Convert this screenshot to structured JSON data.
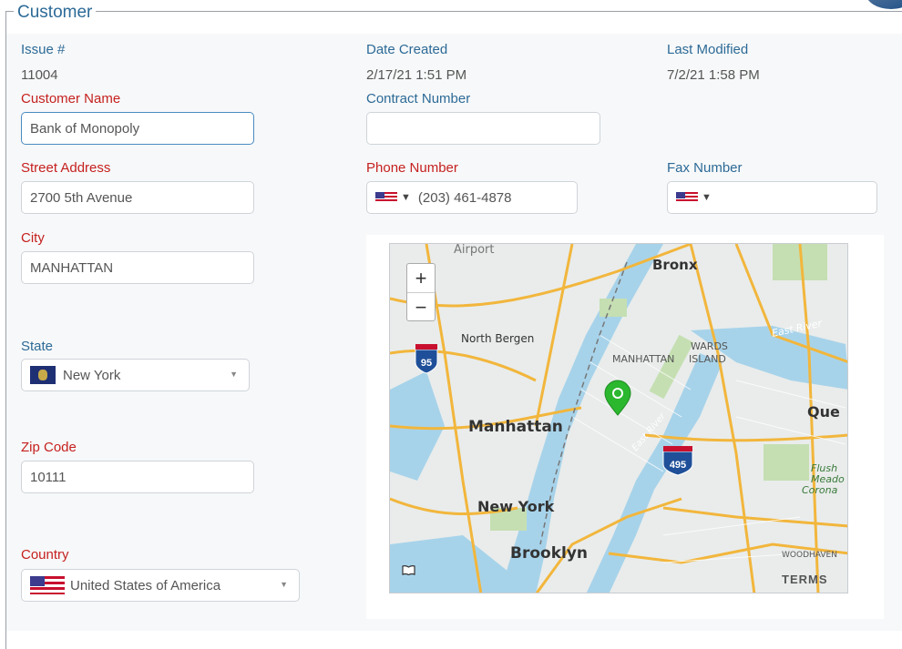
{
  "section": {
    "legend": "Customer"
  },
  "issue": {
    "label": "Issue #",
    "value": "11004"
  },
  "date_created": {
    "label": "Date Created",
    "value": "2/17/21 1:51 PM"
  },
  "last_modified": {
    "label": "Last Modified",
    "value": "7/2/21 1:58 PM"
  },
  "customer_name": {
    "label": "Customer Name",
    "value": "Bank of Monopoly"
  },
  "contract_number": {
    "label": "Contract Number",
    "value": ""
  },
  "street_address": {
    "label": "Street Address",
    "value": "2700 5th Avenue"
  },
  "phone_number": {
    "label": "Phone Number",
    "value": "(203) 461-4878",
    "country_caret": "▼"
  },
  "fax_number": {
    "label": "Fax Number",
    "value": "",
    "country_caret": "▼"
  },
  "city": {
    "label": "City",
    "value": "MANHATTAN"
  },
  "state": {
    "label": "State",
    "value": "New York",
    "arrow": "▼"
  },
  "zip_code": {
    "label": "Zip Code",
    "value": "10111"
  },
  "country": {
    "label": "Country",
    "value": "United States of America",
    "arrow": "▼"
  },
  "map": {
    "zoom_in": "+",
    "zoom_out": "−",
    "terms": "TERMS",
    "labels": {
      "airport": "Airport",
      "bronx": "Bronx",
      "north_bergen": "North Bergen",
      "manhattan_caps": "MANHATTAN",
      "wards": "WARDS",
      "island": "ISLAND",
      "east_river": "East River",
      "east_river_2": "East River",
      "manhattan": "Manhattan",
      "queens": "Que",
      "new_york": "New York",
      "brooklyn": "Brooklyn",
      "flushing": "Flush",
      "meadow": "Meado",
      "corona": "Corona",
      "woodhaven": "WOODHAVEN",
      "i95": "95",
      "i495": "495"
    },
    "colors": {
      "land": "#e9eceb",
      "water": "#a7d3ea",
      "park": "#c5dfb2",
      "road": "#f2b63c",
      "pin": "#2bb72e"
    }
  }
}
